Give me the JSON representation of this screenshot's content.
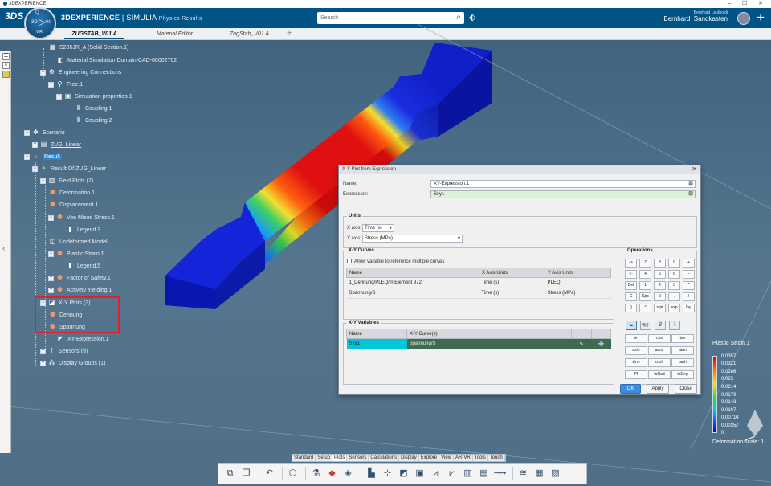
{
  "window": {
    "title": "3DEXPERIENCE",
    "controls": "– ☐ ✕"
  },
  "topbar": {
    "ds_logo": "3DS",
    "compass": {
      "top": "Q",
      "left": "3D",
      "right": "ME",
      "play": "▷",
      "version": "V,R"
    },
    "brand_strong": "3DEXPERIENCE",
    "brand_sep": " | ",
    "brand_app": "SIMULIA",
    "brand_sub": " Physics Results",
    "search_placeholder": "Search",
    "user_small": "Bernhard Leutholdi",
    "user_name": "Bernhard_Sandkasten"
  },
  "tabs": [
    {
      "label": "ZUGSTAB_V01 A",
      "active": true
    },
    {
      "label": "Material Editor",
      "active": false
    },
    {
      "label": "ZugStab_V01 A",
      "active": false
    }
  ],
  "tree": {
    "nodes": [
      {
        "label": "S235JR_A (Solid Section.1)",
        "icon": "section-icon"
      },
      {
        "label": "Material Simulation Domain-CAD-00002762",
        "icon": "material-icon"
      },
      {
        "label": "Engineering Connections",
        "icon": "connections-icon"
      },
      {
        "label": "Free.1",
        "icon": "free-icon"
      },
      {
        "label": "Simulation properties.1",
        "icon": "properties-icon"
      },
      {
        "label": "Coupling.1",
        "icon": "coupling-icon"
      },
      {
        "label": "Coupling.2",
        "icon": "coupling-icon"
      },
      {
        "label": "Scenario",
        "icon": "scenario-icon"
      },
      {
        "label": "ZUG_Linear",
        "icon": "case-icon"
      },
      {
        "label": "Result",
        "icon": "result-icon"
      },
      {
        "label": "Result Of ZUG_Linear",
        "icon": "result-of-icon"
      },
      {
        "label": "Field Plots (7)",
        "icon": "field-plots-icon"
      },
      {
        "label": "Deformation.1",
        "icon": "plot-icon"
      },
      {
        "label": "Displacement.1",
        "icon": "plot-icon"
      },
      {
        "label": "Von Mises Stress.1",
        "icon": "plot-icon"
      },
      {
        "label": "Legend.3",
        "icon": "legend-icon"
      },
      {
        "label": "Undeformed Model",
        "icon": "plot-icon"
      },
      {
        "label": "Plastic Strain.1",
        "icon": "plot-icon"
      },
      {
        "label": "Legend.5",
        "icon": "legend-icon"
      },
      {
        "label": "Factor of Safety.1",
        "icon": "plot-icon"
      },
      {
        "label": "Actively Yielding.1",
        "icon": "plot-icon"
      },
      {
        "label": "X-Y Plots (3)",
        "icon": "xy-plots-icon"
      },
      {
        "label": "Dehnung",
        "icon": "curve-icon"
      },
      {
        "label": "Spannung",
        "icon": "curve-icon"
      },
      {
        "label": "XY-Expression.1",
        "icon": "expression-icon"
      },
      {
        "label": "Sensors (9)",
        "icon": "sensors-icon"
      },
      {
        "label": "Display Groups (1)",
        "icon": "display-groups-icon"
      }
    ]
  },
  "dialog": {
    "title": "X-Y Plot from Expression",
    "name_label": "Name:",
    "name_value": "XY-Expression.1",
    "expression_label": "Expression:",
    "expression_value": "Sxy1",
    "units": {
      "title": "Units",
      "xaxis_label": "X axis:",
      "xaxis_value": "Time (s)",
      "yaxis_label": "Y axis:",
      "yaxis_value": "Stress (MPa)"
    },
    "curves": {
      "title": "X-Y Curves",
      "allow_label": "Allow variable to reference multiple curves",
      "headers": [
        "Name",
        "X Axis Units",
        "Y Axis Units"
      ],
      "rows": [
        [
          "1_Dehnung/PLEQ/in Element 972",
          "Time (s)",
          "PLEQ"
        ],
        [
          "Spannung/S",
          "Time (s)",
          "Stress (MPa)"
        ]
      ]
    },
    "variables": {
      "title": "X-Y Variables",
      "headers": [
        "Name",
        "X-Y Curve(s)",
        "",
        ""
      ],
      "rows": [
        [
          "Sxy1",
          "Spannung/S"
        ]
      ]
    },
    "operations": {
      "title": "Operations",
      "keys": [
        [
          "->",
          "7",
          "8",
          "9",
          "+"
        ],
        [
          "<-",
          "4",
          "5",
          "6",
          "-"
        ],
        [
          "Del",
          "1",
          "2",
          "3",
          "*"
        ],
        [
          "C",
          "Spc",
          "0",
          ".",
          "/"
        ],
        [
          "()",
          "^",
          "sqrt",
          "exp",
          "log"
        ]
      ],
      "tabs": [
        "⊾",
        "f(x)",
        "⊽",
        "⦚"
      ],
      "functions": [
        [
          "sin",
          "cos",
          "tan"
        ],
        [
          "asin",
          "acos",
          "atan"
        ],
        [
          "sinh",
          "cosh",
          "tanh"
        ],
        [
          "PI",
          "toRad",
          "toDeg"
        ]
      ]
    },
    "buttons": {
      "ok": "OK",
      "apply": "Apply",
      "close": "Close"
    }
  },
  "legend": {
    "title": "Plastic Strain.1",
    "ticks": [
      "0.0357",
      "0.0321",
      "0.0286",
      "0.025",
      "0.0214",
      "0.0179",
      "0.0143",
      "0.0107",
      "0.00714",
      "0.00357",
      "0"
    ],
    "deformation": "Deformation scale: 1",
    "colors": [
      "#e00000",
      "#ff7a00",
      "#f6e600",
      "#40d040",
      "#00c8d8",
      "#1c40ff",
      "#0010b0"
    ]
  },
  "bottom": {
    "tabs": [
      "Standard",
      "Setup",
      "Plots",
      "Sensors",
      "Calculations",
      "Display",
      "Explore",
      "View",
      "AR-VR",
      "Tools",
      "Touch"
    ],
    "active_tab": "Plots",
    "tools": [
      "copy-icon",
      "paste-icon",
      "undo-icon",
      "cube-icon",
      "deform-icon",
      "color-plot-icon",
      "iso-icon",
      "bar-plot-icon",
      "probe-icon",
      "cut-icon",
      "slice-icon",
      "xy-plot-icon",
      "xy-expression-icon",
      "chart-icon",
      "table-icon",
      "animation-icon",
      "stack-icon",
      "image-icon",
      "report-icon"
    ]
  },
  "colors": {
    "accent": "#005386",
    "selection": "#2a85d0",
    "variable_cell": "#00c8d8",
    "variable_curve": "#3f6a4f"
  }
}
